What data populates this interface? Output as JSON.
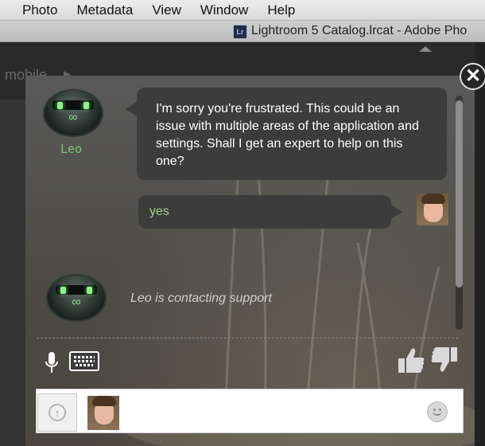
{
  "menubar": {
    "items": [
      "Photo",
      "Metadata",
      "View",
      "Window",
      "Help"
    ]
  },
  "window": {
    "app_icon_label": "Lr",
    "title": "Lightroom 5 Catalog.lrcat - Adobe Pho"
  },
  "lightroom": {
    "mobile_label": "mobile"
  },
  "chat": {
    "agent_name": "Leo",
    "messages": [
      {
        "from": "agent",
        "text": "I'm sorry you're frustrated.  This could be an issue with multiple areas of the application and settings.  Shall I get an expert to help on this one?"
      },
      {
        "from": "user",
        "text": "yes"
      }
    ],
    "status": "Leo is contacting support",
    "input": {
      "value": "",
      "placeholder": ""
    }
  },
  "icons": {
    "close": "close-icon",
    "microphone": "microphone-icon",
    "keyboard": "keyboard-icon",
    "thumbs_up": "thumbs-up-icon",
    "thumbs_down": "thumbs-down-icon",
    "upload": "upload-icon",
    "emoji": "emoji-icon"
  },
  "colors": {
    "agent_name": "#7cc96f",
    "user_text": "#9bd686",
    "bubble": "#3c3c3c"
  }
}
